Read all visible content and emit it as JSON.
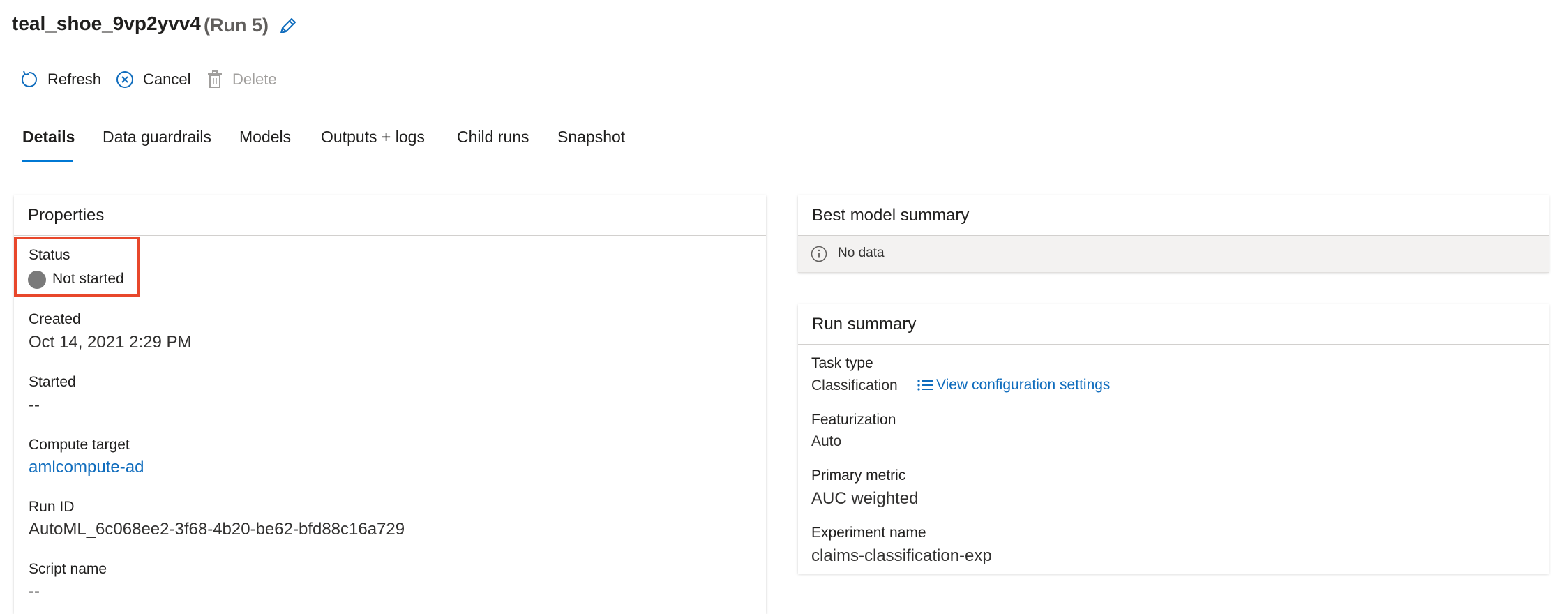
{
  "header": {
    "title": "teal_shoe_9vp2yvv4",
    "run_label": "(Run 5)"
  },
  "toolbar": {
    "refresh_label": "Refresh",
    "cancel_label": "Cancel",
    "delete_label": "Delete"
  },
  "tabs": [
    {
      "label": "Details"
    },
    {
      "label": "Data guardrails"
    },
    {
      "label": "Models"
    },
    {
      "label": "Outputs + logs"
    },
    {
      "label": "Child runs"
    },
    {
      "label": "Snapshot"
    }
  ],
  "properties": {
    "title": "Properties",
    "status_label": "Status",
    "status_value": "Not started",
    "created_label": "Created",
    "created_value": "Oct 14, 2021 2:29 PM",
    "started_label": "Started",
    "started_value": "--",
    "compute_label": "Compute target",
    "compute_value": "amlcompute-ad",
    "runid_label": "Run ID",
    "runid_value": "AutoML_6c068ee2-3f68-4b20-be62-bfd88c16a729",
    "script_label": "Script name",
    "script_value": "--"
  },
  "best_model": {
    "title": "Best model summary",
    "no_data": "No data"
  },
  "run_summary": {
    "title": "Run summary",
    "task_label": "Task type",
    "task_value": "Classification",
    "view_config": "View configuration settings",
    "featurization_label": "Featurization",
    "featurization_value": "Auto",
    "metric_label": "Primary metric",
    "metric_value": "AUC weighted",
    "experiment_label": "Experiment name",
    "experiment_value": "claims-classification-exp"
  },
  "colors": {
    "accent": "#0078d4",
    "link": "#0f6cbd",
    "highlight": "#e8472b",
    "status_not_started": "#7a7a7a"
  }
}
